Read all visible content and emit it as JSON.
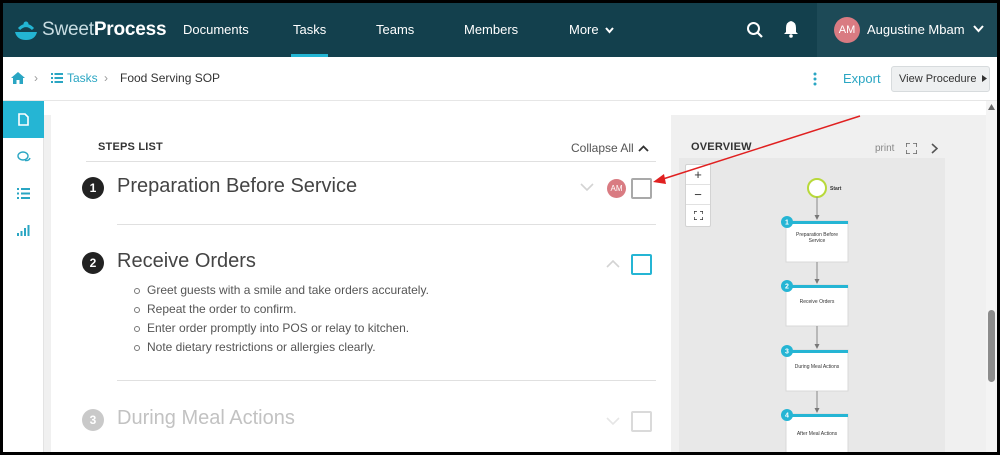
{
  "brand": {
    "name_light": "Sweet",
    "name_bold": "Process"
  },
  "nav": {
    "items": [
      {
        "label": "Documents"
      },
      {
        "label": "Tasks"
      },
      {
        "label": "Teams"
      },
      {
        "label": "Members"
      },
      {
        "label": "More"
      }
    ],
    "active": "Tasks"
  },
  "user": {
    "initials": "AM",
    "name": "Augustine Mbam"
  },
  "breadcrumb": {
    "tasks": "Tasks",
    "current": "Food Serving SOP"
  },
  "toolbar": {
    "export": "Export",
    "view_procedure": "View Procedure"
  },
  "steps": {
    "heading": "STEPS LIST",
    "collapse_all": "Collapse All",
    "items": [
      {
        "number": "1",
        "title": "Preparation Before Service",
        "assignee": "AM"
      },
      {
        "number": "2",
        "title": "Receive Orders",
        "bullets": [
          "Greet guests with a smile and take orders accurately.",
          "Repeat the order to confirm.",
          "Enter order promptly into POS or relay to kitchen.",
          "Note dietary restrictions or allergies clearly."
        ]
      },
      {
        "number": "3",
        "title": "During Meal Actions"
      }
    ]
  },
  "overview": {
    "heading": "OVERVIEW",
    "print": "print",
    "zoom_in": "+",
    "zoom_out": "−",
    "start_label": "Start",
    "nodes": [
      {
        "number": "1",
        "label": "Preparation Before Service"
      },
      {
        "number": "2",
        "label": "Receive Orders"
      },
      {
        "number": "3",
        "label": "During Meal Actions"
      },
      {
        "number": "4",
        "label": "After Meal Actions"
      }
    ]
  },
  "colors": {
    "nav_bg": "#13404d",
    "accent": "#25b5d4",
    "avatar": "#d97b82",
    "annotation": "#e02020"
  }
}
